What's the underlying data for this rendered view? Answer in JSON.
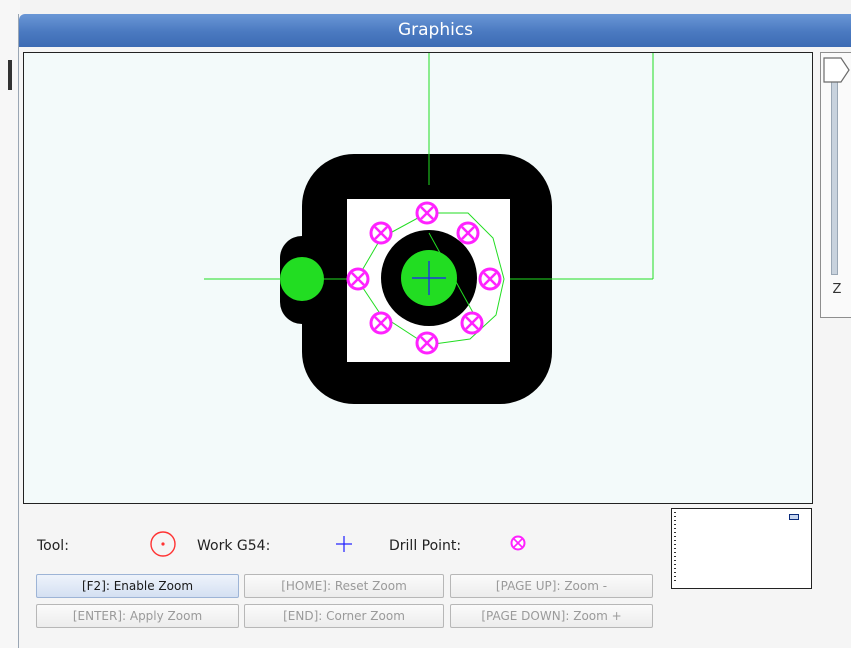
{
  "window": {
    "title": "Graphics"
  },
  "z_slider": {
    "label": "Z"
  },
  "legend": {
    "tool_label": "Tool:",
    "work_label": "Work G54:",
    "drill_label": "Drill Point:",
    "tool_icon": "tool-circle-icon",
    "work_icon": "work-crosshair-icon",
    "drill_icon": "drill-point-icon"
  },
  "buttons": {
    "enable_zoom": "[F2]: Enable Zoom",
    "reset_zoom": "[HOME]: Reset Zoom",
    "zoom_out": "[PAGE UP]: Zoom -",
    "apply_zoom": "[ENTER]: Apply Zoom",
    "corner_zoom": "[END]: Corner Zoom",
    "zoom_in": "[PAGE DOWN]: Zoom +"
  },
  "colors": {
    "title_bar": "#4a79c0",
    "part": "#000000",
    "path": "#22dd22",
    "drill_point": "#ff22ff",
    "tool": "#ff3333",
    "work_origin": "#1c1cff"
  }
}
